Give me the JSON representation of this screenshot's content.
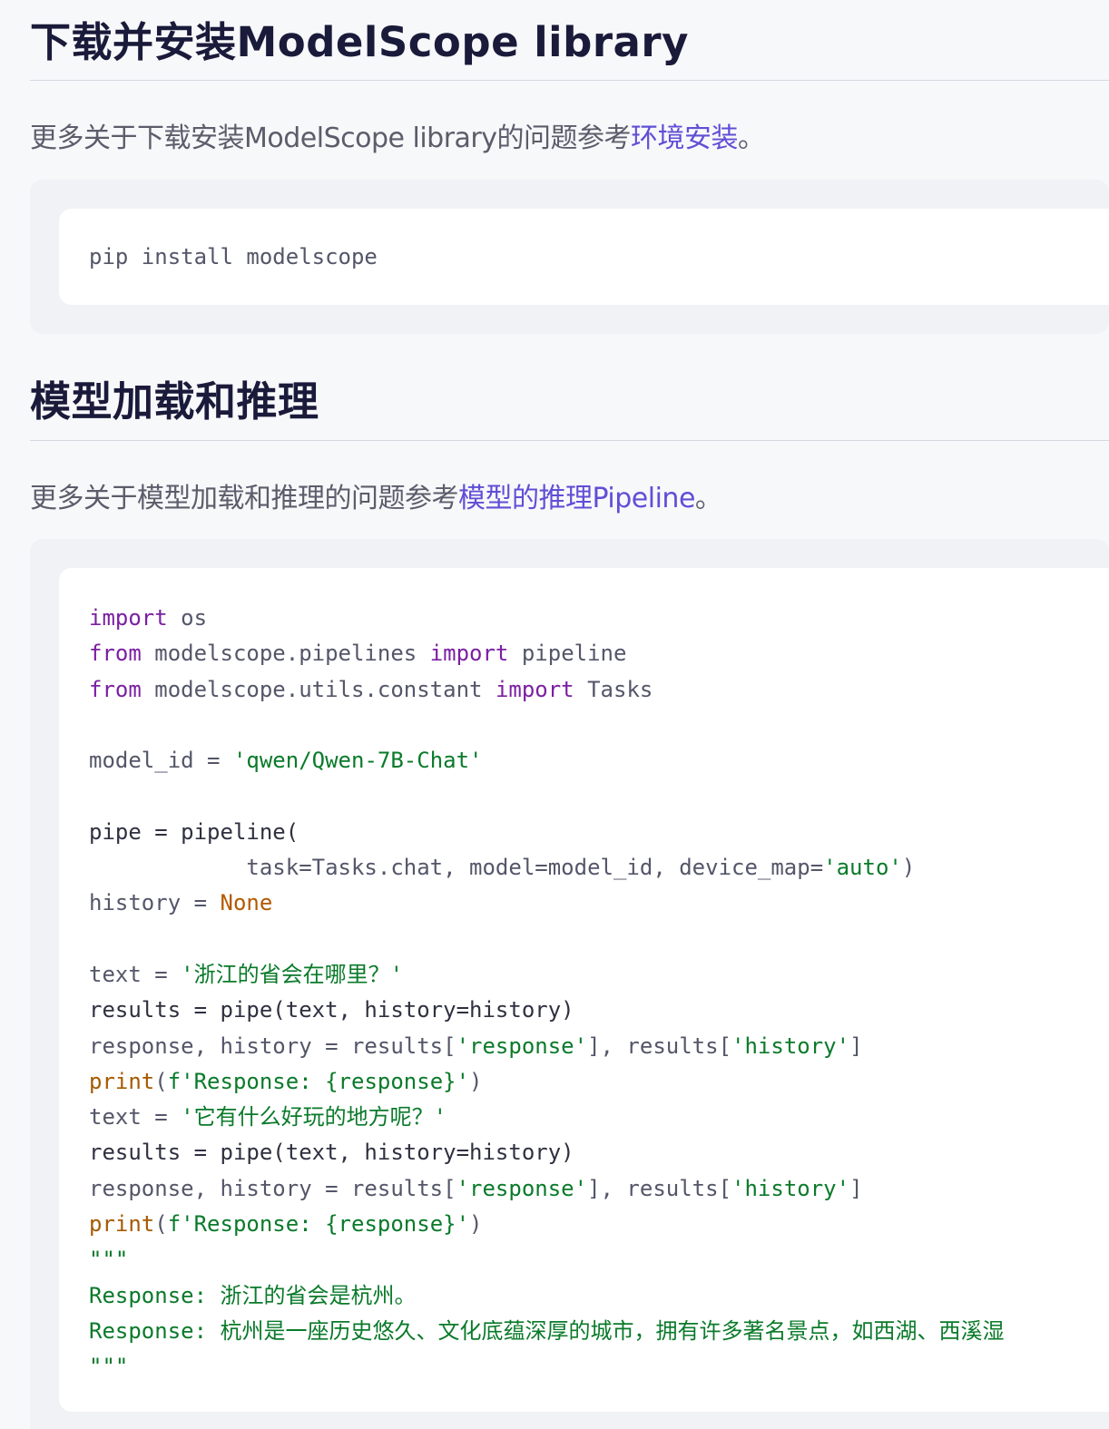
{
  "section1": {
    "title": "下载并安装ModelScope library",
    "desc_prefix": "更多关于下载安装ModelScope library的问题参考",
    "link_text": "环境安装",
    "desc_suffix": "。",
    "code": "pip install modelscope"
  },
  "section2": {
    "title": "模型加载和推理",
    "desc_prefix": "更多关于模型加载和推理的问题参考",
    "link_text": "模型的推理Pipeline",
    "desc_suffix": "。",
    "code": {
      "l1_kw": "import",
      "l1_rest": " os",
      "l2_kw": "from",
      "l2_mid": " modelscope.pipelines ",
      "l2_kw2": "import",
      "l2_rest": " pipeline",
      "l3_kw": "from",
      "l3_mid": " modelscope.utils.constant ",
      "l3_kw2": "import",
      "l3_rest": " Tasks",
      "l5_pre": "model_id = ",
      "l5_str": "'qwen/Qwen-7B-Chat'",
      "l7": "pipe = pipeline(",
      "l8_pre": "            task=Tasks.chat, model=model_id, device_map=",
      "l8_str": "'auto'",
      "l8_post": ")",
      "l9_pre": "history = ",
      "l9_val": "None",
      "l11_pre": "text = ",
      "l11_str": "'浙江的省会在哪里？'",
      "l12": "results = pipe(text, history=history)",
      "l13_a": "response, history = results[",
      "l13_s1": "'response'",
      "l13_b": "], results[",
      "l13_s2": "'history'",
      "l13_c": "]",
      "l14_fn": "print",
      "l14_a": "(",
      "l14_str": "f'Response: {response}'",
      "l14_b": ")",
      "l15_pre": "text = ",
      "l15_str": "'它有什么好玩的地方呢？'",
      "l16": "results = pipe(text, history=history)",
      "l17_a": "response, history = results[",
      "l17_s1": "'response'",
      "l17_b": "], results[",
      "l17_s2": "'history'",
      "l17_c": "]",
      "l18_fn": "print",
      "l18_a": "(",
      "l18_str": "f'Response: {response}'",
      "l18_b": ")",
      "l19": "\"\"\"",
      "l20": "Response: 浙江的省会是杭州。",
      "l21": "Response: 杭州是一座历史悠久、文化底蕴深厚的城市，拥有许多著名景点，如西湖、西溪湿",
      "l22": "\"\"\""
    }
  },
  "colors": {
    "link": "#5f4fd6",
    "keyword": "#7b1fa2",
    "string": "#0a7a2a",
    "constant": "#b35a00"
  }
}
